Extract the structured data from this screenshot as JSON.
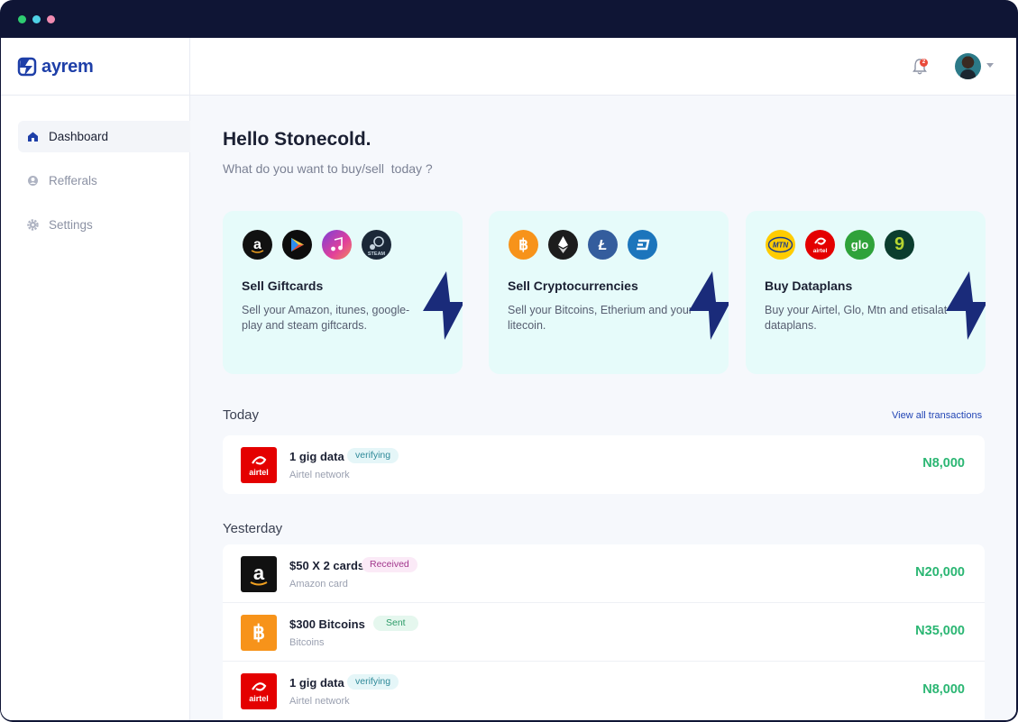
{
  "window": {
    "controls": [
      "green-dot",
      "cyan-dot",
      "pink-dot"
    ]
  },
  "brand": {
    "name": "ayrem",
    "color": "#1e3fa8"
  },
  "sidebar": {
    "items": [
      {
        "label": "Dashboard",
        "icon": "home-icon",
        "active": true
      },
      {
        "label": "Refferals",
        "icon": "referral-icon",
        "active": false
      },
      {
        "label": "Settings",
        "icon": "gear-icon",
        "active": false
      }
    ]
  },
  "header": {
    "notification_icon": "bell-icon",
    "notification_count": "2",
    "avatar_icon": "avatar"
  },
  "main": {
    "greeting": "Hello Stonecold.",
    "subgreeting": "What do you want to buy/sell  today ?",
    "cards": [
      {
        "title": "Sell Giftcards",
        "description": "Sell your Amazon, itunes, google-play and steam giftcards.",
        "icons": [
          "amazon-icon",
          "google-play-icon",
          "itunes-icon",
          "steam-icon"
        ]
      },
      {
        "title": "Sell Cryptocurrencies",
        "description": "Sell your Bitcoins, Etherium and your litecoin.",
        "icons": [
          "bitcoin-icon",
          "ethereum-icon",
          "litecoin-icon",
          "dash-icon"
        ]
      },
      {
        "title": "Buy Dataplans",
        "description": "Buy your Airtel, Glo, Mtn and etisalat dataplans.",
        "icons": [
          "mtn-icon",
          "airtel-icon",
          "glo-icon",
          "9mobile-icon"
        ]
      }
    ],
    "today": {
      "title": "Today",
      "view_all": "View all transactions",
      "transactions": [
        {
          "name": "1 gig data",
          "status": "verifying",
          "subtitle": "Airtel network",
          "amount": "N8,000",
          "logo": "airtel-logo"
        }
      ]
    },
    "yesterday": {
      "title": "Yesterday",
      "transactions": [
        {
          "name": "$50 X 2 cards",
          "status": "Received",
          "subtitle": "Amazon card",
          "amount": "N20,000",
          "logo": "amazon-logo"
        },
        {
          "name": "$300 Bitcoins",
          "status": "Sent",
          "subtitle": "Bitcoins",
          "amount": "N35,000",
          "logo": "bitcoin-logo"
        },
        {
          "name": "1 gig data",
          "status": "verifying",
          "subtitle": "Airtel network",
          "amount": "N8,000",
          "logo": "airtel-logo"
        }
      ]
    }
  },
  "colors": {
    "accent": "#1e3fa8",
    "card_bg": "#e6fbfa",
    "amount": "#2bb673",
    "bolt": "#1a2b7a"
  }
}
